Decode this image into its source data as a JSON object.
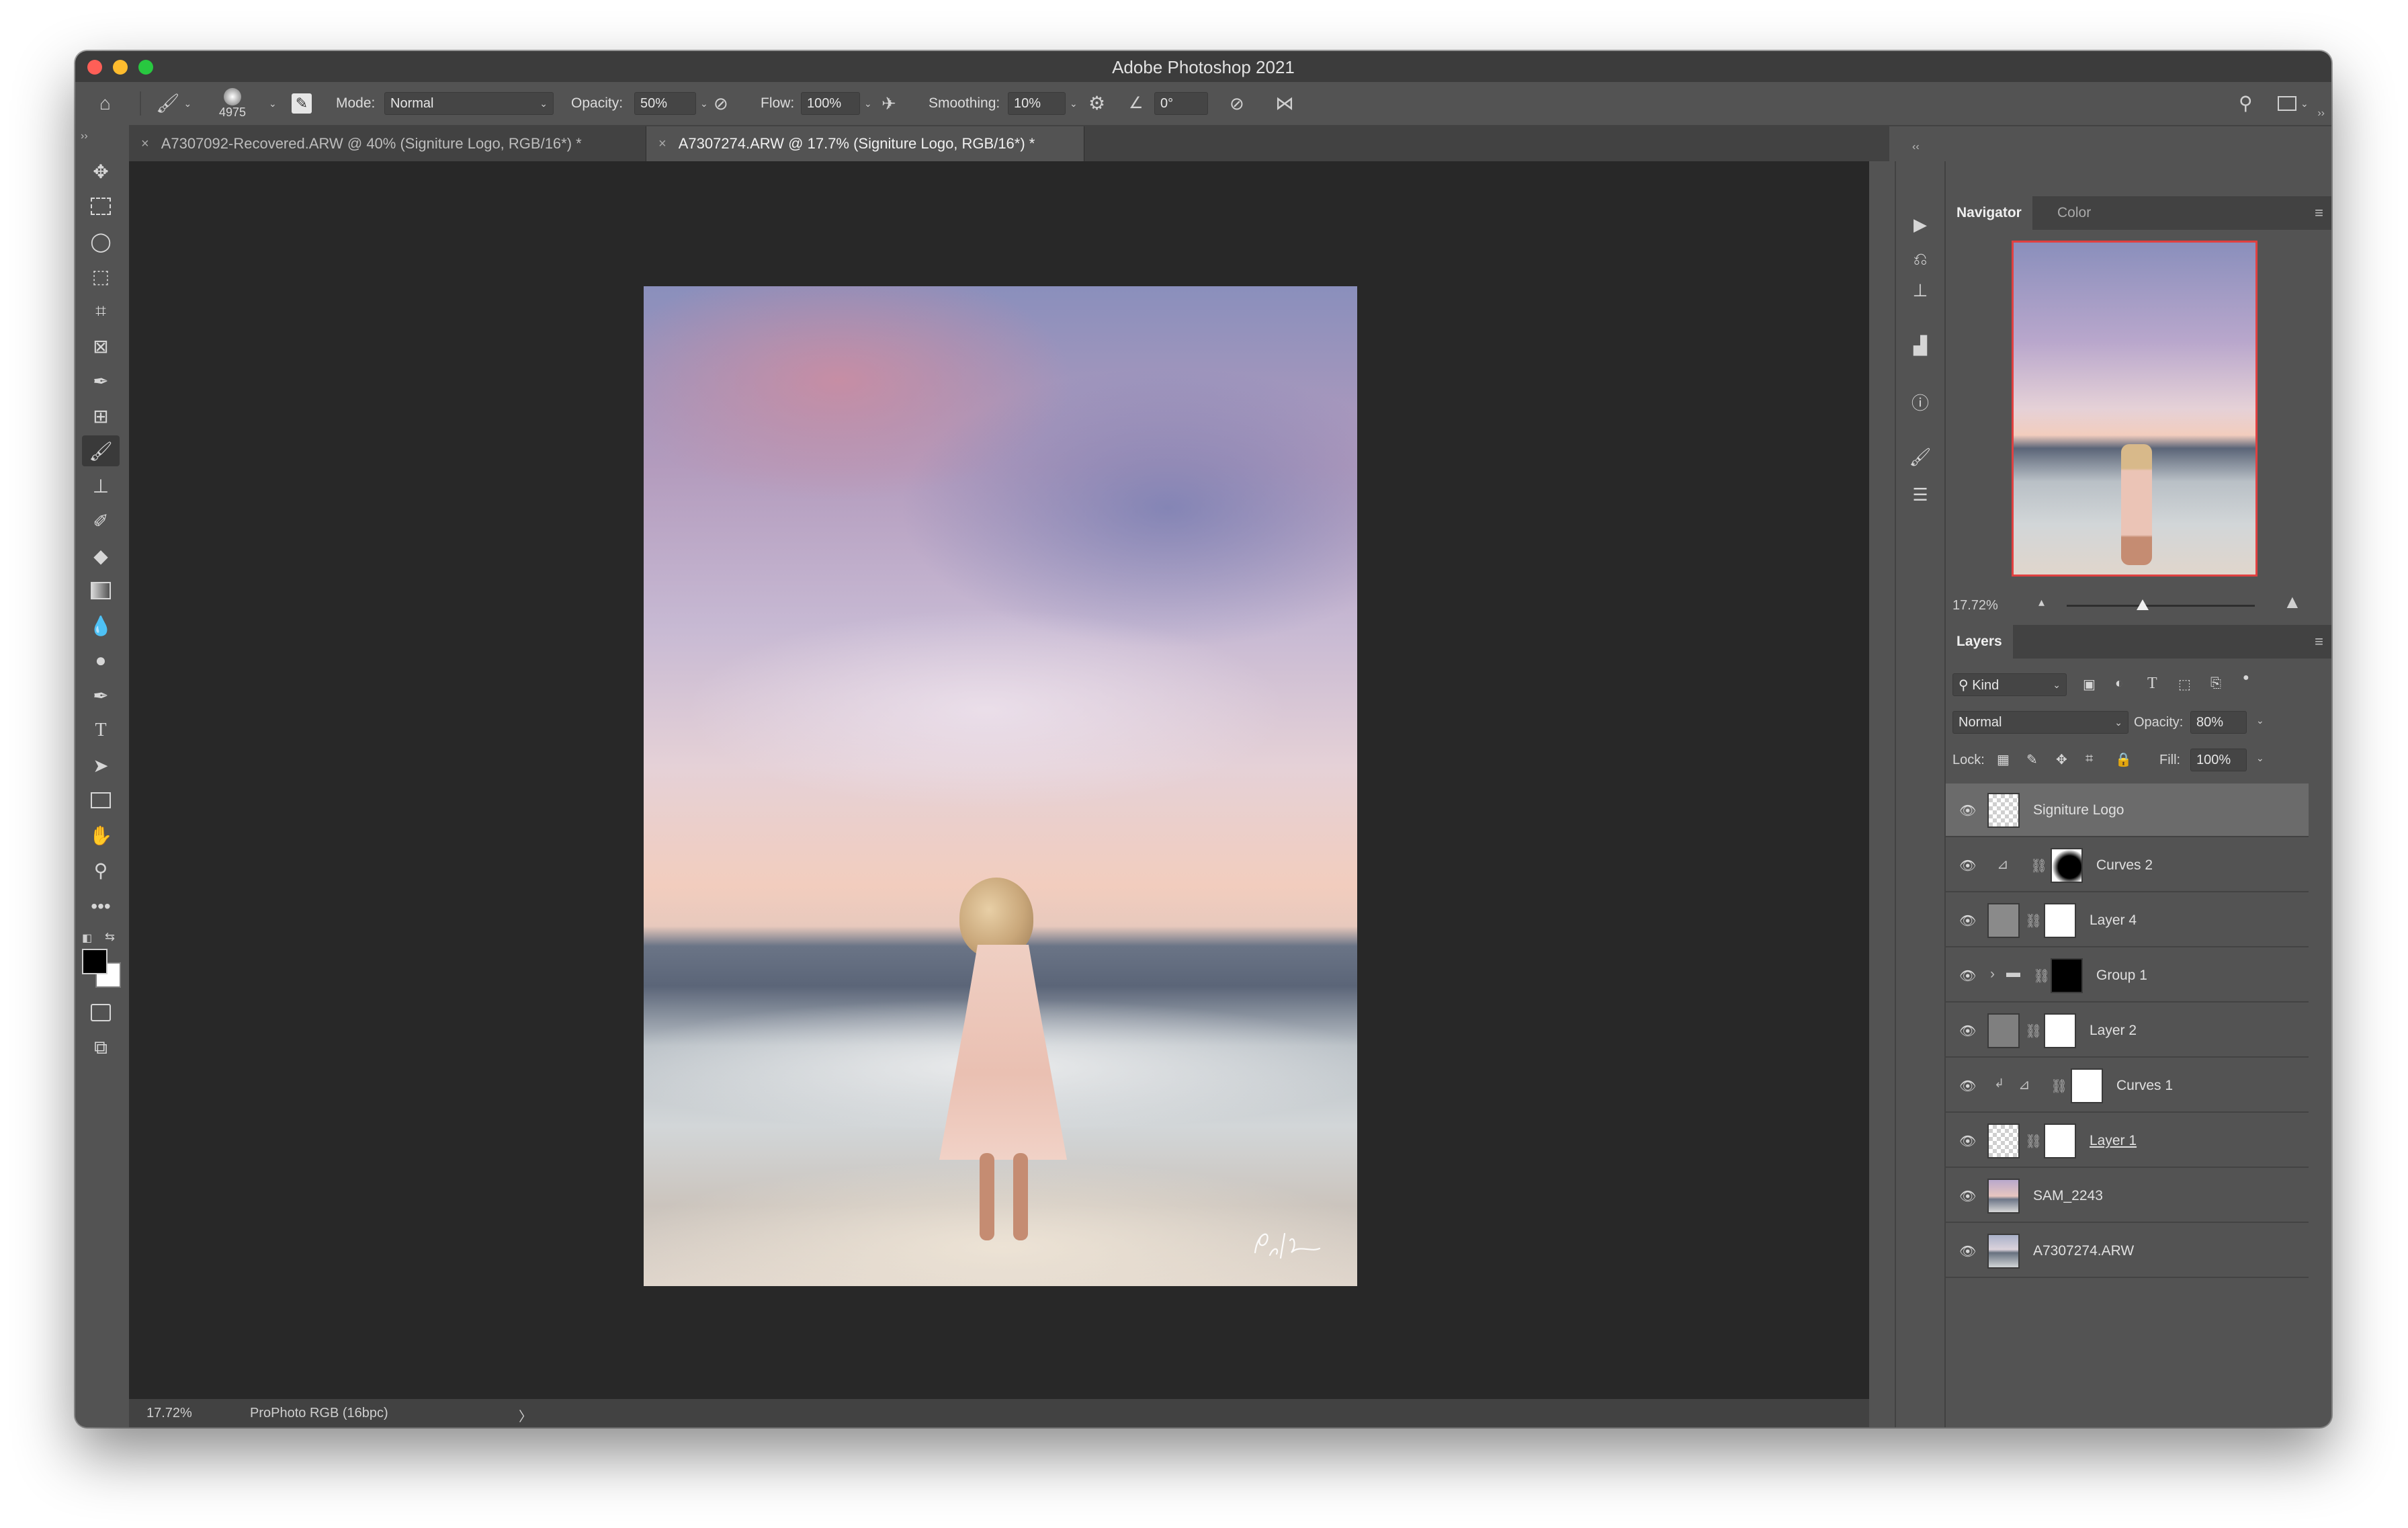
{
  "window": {
    "title": "Adobe Photoshop 2021"
  },
  "options_bar": {
    "brush_size": "4975",
    "mode_label": "Mode:",
    "mode_value": "Normal",
    "opacity_label": "Opacity:",
    "opacity_value": "50%",
    "flow_label": "Flow:",
    "flow_value": "100%",
    "smoothing_label": "Smoothing:",
    "smoothing_value": "10%",
    "angle_value": "0°"
  },
  "tabs": [
    {
      "label": "A7307092-Recovered.ARW @ 40% (Signiture Logo, RGB/16*) *",
      "active": false
    },
    {
      "label": "A7307274.ARW @ 17.7% (Signiture Logo, RGB/16*) *",
      "active": true
    }
  ],
  "status_bar": {
    "zoom": "17.72%",
    "profile": "ProPhoto RGB (16bpc)",
    "arrow": "〉"
  },
  "navigator": {
    "tabs": [
      "Navigator",
      "Color"
    ],
    "zoom": "17.72%"
  },
  "layers_panel": {
    "title": "Layers",
    "filter_kind": "Kind",
    "blend_mode": "Normal",
    "opacity_label": "Opacity:",
    "opacity_value": "80%",
    "lock_label": "Lock:",
    "fill_label": "Fill:",
    "fill_value": "100%",
    "layers": [
      {
        "name": "Signiture Logo",
        "selected": true
      },
      {
        "name": "Curves 2"
      },
      {
        "name": "Layer 4"
      },
      {
        "name": "Group 1"
      },
      {
        "name": "Layer 2"
      },
      {
        "name": "Curves 1"
      },
      {
        "name": "Layer 1"
      },
      {
        "name": "SAM_2243"
      },
      {
        "name": "A7307274.ARW"
      }
    ]
  },
  "colors": {
    "accent_close": "#fe5f57",
    "accent_min": "#febc2e",
    "accent_max": "#28c840",
    "navigator_frame": "#e04040"
  }
}
